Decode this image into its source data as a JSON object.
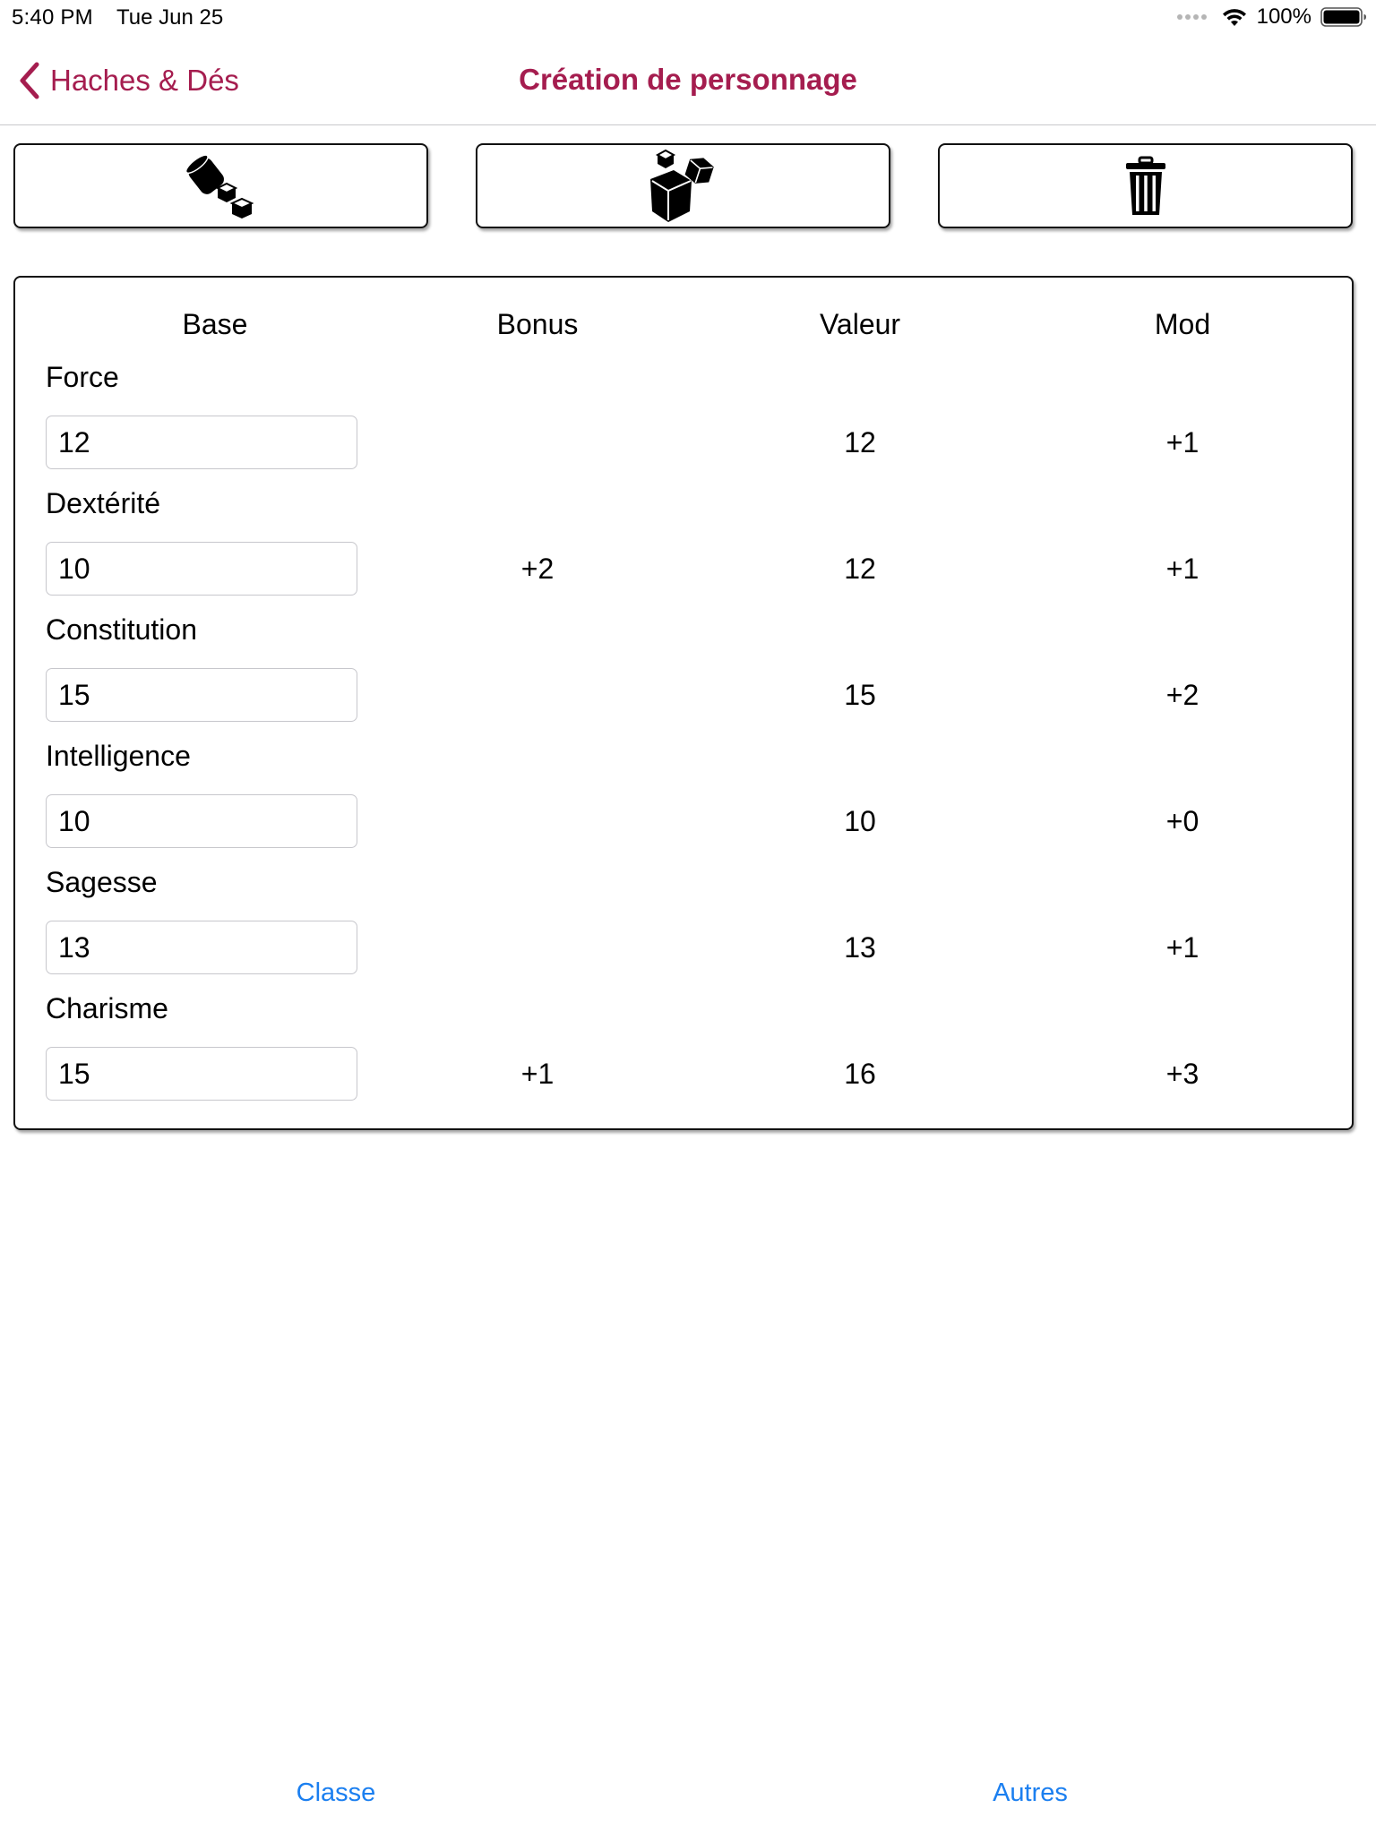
{
  "status_bar": {
    "time": "5:40 PM",
    "date": "Tue Jun 25",
    "battery": "100%",
    "icons": [
      "signal-dots-icon",
      "wifi-icon",
      "battery-icon"
    ]
  },
  "nav": {
    "back_label": "Haches & Dés",
    "title": "Création de personnage",
    "accent_color": "#a51d4f"
  },
  "toolbar": {
    "buttons": [
      {
        "icon": "rolling-dice-icon"
      },
      {
        "icon": "dice-icon"
      },
      {
        "icon": "trash-icon"
      }
    ]
  },
  "stats": {
    "headers": {
      "base": "Base",
      "bonus": "Bonus",
      "valeur": "Valeur",
      "mod": "Mod"
    },
    "rows": [
      {
        "label": "Force",
        "base": "12",
        "bonus": "",
        "valeur": "12",
        "mod": "+1"
      },
      {
        "label": "Dextérité",
        "base": "10",
        "bonus": "+2",
        "valeur": "12",
        "mod": "+1"
      },
      {
        "label": "Constitution",
        "base": "15",
        "bonus": "",
        "valeur": "15",
        "mod": "+2"
      },
      {
        "label": "Intelligence",
        "base": "10",
        "bonus": "",
        "valeur": "10",
        "mod": "+0"
      },
      {
        "label": "Sagesse",
        "base": "13",
        "bonus": "",
        "valeur": "13",
        "mod": "+1"
      },
      {
        "label": "Charisme",
        "base": "15",
        "bonus": "+1",
        "valeur": "16",
        "mod": "+3"
      }
    ]
  },
  "tabs": {
    "classe": "Classe",
    "autres": "Autres",
    "link_color": "#1b7ff0"
  }
}
